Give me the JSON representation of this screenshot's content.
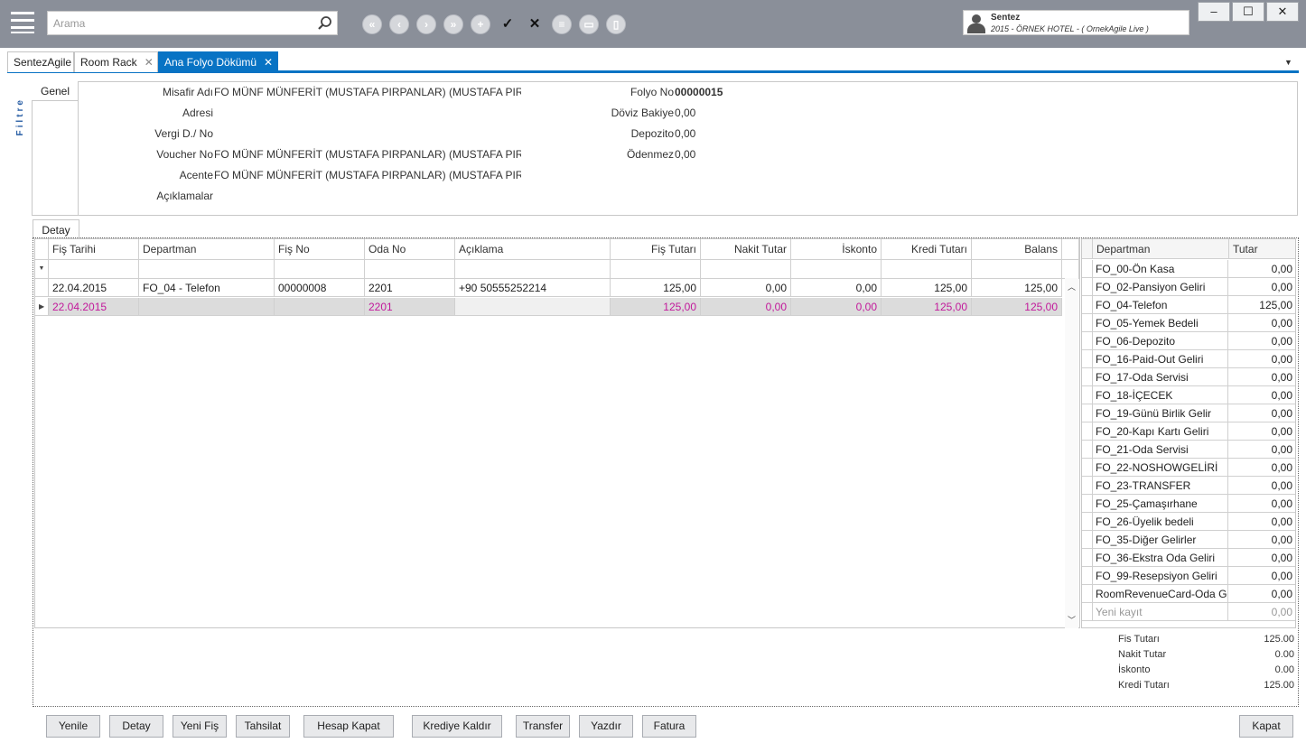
{
  "toolbar": {
    "search_placeholder": "Arama",
    "nav_icons": [
      "first-page-icon",
      "prev-icon",
      "next-icon",
      "last-page-icon",
      "add-icon",
      "check-icon",
      "close-icon",
      "list-icon",
      "keyboard-icon",
      "trash-icon"
    ]
  },
  "user": {
    "name": "Sentez",
    "hotel": "2015 - ÖRNEK HOTEL - ( OrnekAgile Live )"
  },
  "window_controls": {
    "minimize": "‒",
    "maximize": "☐",
    "close": "✕"
  },
  "tabs": [
    {
      "label": "SentezAgile"
    },
    {
      "label": "Room Rack",
      "close": "✕"
    },
    {
      "label": "Ana Folyo Dökümü",
      "close": "✕"
    }
  ],
  "filter_label": "Filtre",
  "genel": {
    "tab_label": "Genel",
    "fields": {
      "misafir_label": "Misafir Adı",
      "misafir_value": "FO MÜNF MÜNFERİT (MUSTAFA PIRPANLAR) (MUSTAFA PIRPANLAR)",
      "adres_label": "Adresi",
      "adres_value": "",
      "vergi_label": "Vergi D./ No",
      "vergi_value": "",
      "voucher_label": "Voucher No",
      "voucher_value": "FO MÜNF MÜNFERİT (MUSTAFA PIRPANLAR) (MUSTAFA PIRPANLAR)",
      "acente_label": "Acente",
      "acente_value": "FO MÜNF MÜNFERİT (MUSTAFA PIRPANLAR) (MUSTAFA PIRPANLAR)",
      "aciklamalar_label": "Açıklamalar",
      "folyo_label": "Folyo No",
      "folyo_value": "00000015",
      "doviz_label": "Döviz Bakiye",
      "doviz_value": "0,00",
      "depozito_label": "Depozito",
      "depozito_value": "0,00",
      "odenmez_label": "Ödenmez",
      "odenmez_value": "0,00"
    }
  },
  "detay": {
    "tab_label": "Detay",
    "filter_icon": "▼",
    "columns": [
      "Fiş Tarihi",
      "Departman",
      "Fiş No",
      "Oda No",
      "Açıklama",
      "Fiş Tutarı",
      "Nakit Tutar",
      "İskonto",
      "Kredi Tutarı",
      "Balans"
    ],
    "rows": [
      {
        "tarih": "22.04.2015",
        "departman": "FO_04 - Telefon",
        "fis_no": "00000008",
        "oda_no": "2201",
        "aciklama": "+90 50555252214",
        "fis_tutari": "125,00",
        "nakit": "0,00",
        "iskonto": "0,00",
        "kredi": "125,00",
        "balans": "125,00"
      },
      {
        "tarih": "22.04.2015",
        "departman": "",
        "fis_no": "",
        "oda_no": "2201",
        "aciklama": "",
        "fis_tutari": "125,00",
        "nakit": "0,00",
        "iskonto": "0,00",
        "kredi": "125,00",
        "balans": "125,00"
      }
    ]
  },
  "summary": {
    "columns": [
      "Departman",
      "Tutar"
    ],
    "rows": [
      {
        "d": "FO_00-Ön Kasa",
        "t": "0,00"
      },
      {
        "d": "FO_02-Pansiyon Geliri",
        "t": "0,00"
      },
      {
        "d": "FO_04-Telefon",
        "t": "125,00"
      },
      {
        "d": "FO_05-Yemek Bedeli",
        "t": "0,00"
      },
      {
        "d": "FO_06-Depozito",
        "t": "0,00"
      },
      {
        "d": "FO_16-Paid-Out Geliri",
        "t": "0,00"
      },
      {
        "d": "FO_17-Oda Servisi",
        "t": "0,00"
      },
      {
        "d": "FO_18-İÇECEK",
        "t": "0,00"
      },
      {
        "d": "FO_19-Günü Birlik Gelir",
        "t": "0,00"
      },
      {
        "d": "FO_20-Kapı Kartı Geliri",
        "t": "0,00"
      },
      {
        "d": "FO_21-Oda Servisi",
        "t": "0,00"
      },
      {
        "d": "FO_22-NOSHOWGELİRİ",
        "t": "0,00"
      },
      {
        "d": "FO_23-TRANSFER",
        "t": "0,00"
      },
      {
        "d": "FO_25-Çamaşırhane",
        "t": "0,00"
      },
      {
        "d": "FO_26-Üyelik bedeli",
        "t": "0,00"
      },
      {
        "d": "FO_35-Diğer Gelirler",
        "t": "0,00"
      },
      {
        "d": "FO_36-Ekstra Oda Geliri",
        "t": "0,00"
      },
      {
        "d": "FO_99-Resepsiyon Geliri",
        "t": "0,00"
      },
      {
        "d": "RoomRevenueCard-Oda Geliri",
        "t": "0,00"
      }
    ],
    "new_row": {
      "d": "Yeni kayıt",
      "t": "0,00"
    }
  },
  "totals": [
    {
      "label": "Fis Tutarı",
      "value": "125.00"
    },
    {
      "label": "Nakit Tutar",
      "value": "0.00"
    },
    {
      "label": "İskonto",
      "value": "0.00"
    },
    {
      "label": "Kredi Tutarı",
      "value": "125.00"
    }
  ],
  "buttons": {
    "yenile": "Yenile",
    "detay": "Detay",
    "yeni_fis": "Yeni Fiş",
    "tahsilat": "Tahsilat",
    "hesap_kapat": "Hesap Kapat",
    "krediye_kaldir": "Krediye Kaldır",
    "transfer": "Transfer",
    "yazdir": "Yazdır",
    "fatura": "Fatura",
    "kapat": "Kapat"
  },
  "colors": {
    "accent": "#0873c4",
    "topbar": "#8a8f99",
    "highlight_text": "#c2189b"
  }
}
